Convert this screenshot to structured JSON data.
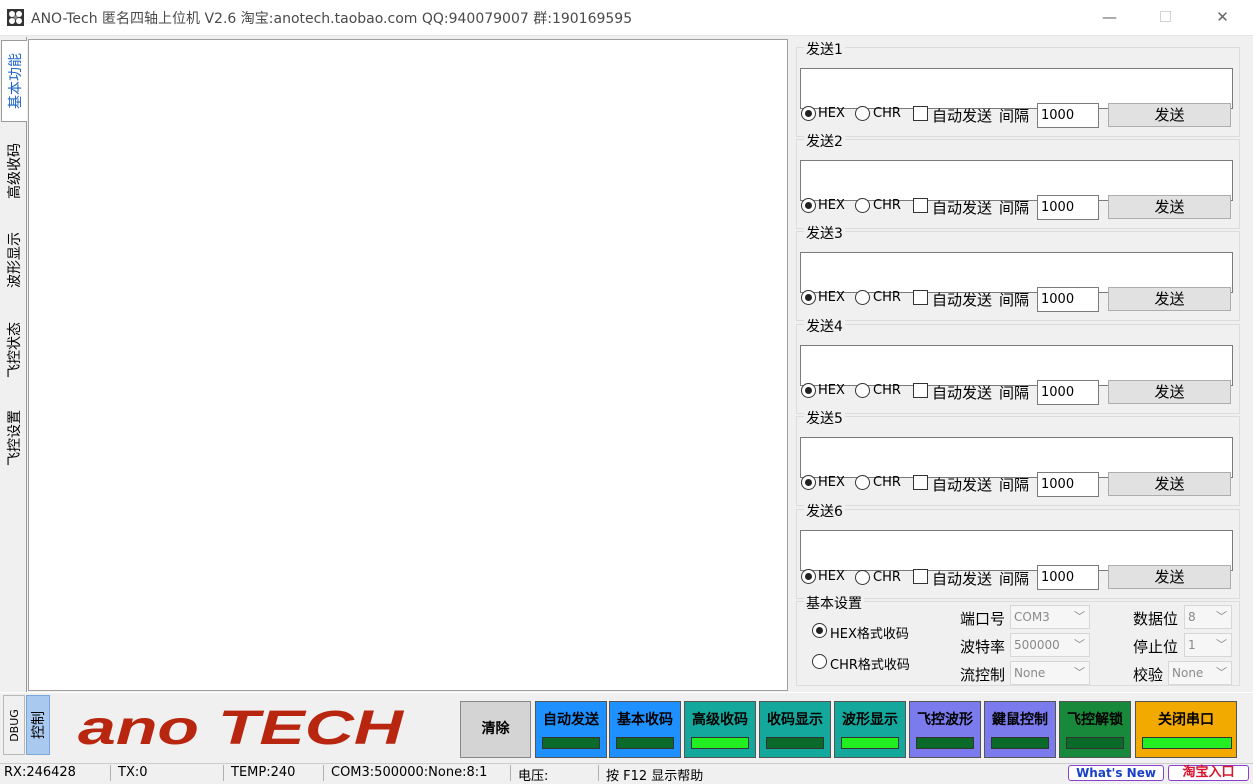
{
  "window": {
    "title": "ANO-Tech  匿名四轴上位机   V2.6  淘宝:anotech.taobao.com   QQ:940079007  群:190169595",
    "minimize": "—",
    "maximize": "☐",
    "close": "✕"
  },
  "left_tabs": [
    "基本功能",
    "高级收码",
    "波形显示",
    "飞控状态",
    "飞控设置"
  ],
  "send_groups": [
    {
      "label": "发送1",
      "hex": "HEX",
      "chr": "CHR",
      "auto": "自动发送",
      "interval_label": "间隔",
      "interval": "1000",
      "send": "发送",
      "selected": "hex"
    },
    {
      "label": "发送2",
      "hex": "HEX",
      "chr": "CHR",
      "auto": "自动发送",
      "interval_label": "间隔",
      "interval": "1000",
      "send": "发送",
      "selected": "hex"
    },
    {
      "label": "发送3",
      "hex": "HEX",
      "chr": "CHR",
      "auto": "自动发送",
      "interval_label": "间隔",
      "interval": "1000",
      "send": "发送",
      "selected": "hex"
    },
    {
      "label": "发送4",
      "hex": "HEX",
      "chr": "CHR",
      "auto": "自动发送",
      "interval_label": "间隔",
      "interval": "1000",
      "send": "发送",
      "selected": "hex"
    },
    {
      "label": "发送5",
      "hex": "HEX",
      "chr": "CHR",
      "auto": "自动发送",
      "interval_label": "间隔",
      "interval": "1000",
      "send": "发送",
      "selected": "hex"
    },
    {
      "label": "发送6",
      "hex": "HEX",
      "chr": "CHR",
      "auto": "自动发送",
      "interval_label": "间隔",
      "interval": "1000",
      "send": "发送",
      "selected": "hex"
    }
  ],
  "settings": {
    "title": "基本设置",
    "hex_mode": "HEX格式收码",
    "chr_mode": "CHR格式收码",
    "port_label": "端口号",
    "port": "COM3",
    "baud_label": "波特率",
    "baud": "500000",
    "flow_label": "流控制",
    "flow": "None",
    "databits_label": "数据位",
    "databits": "8",
    "stopbits_label": "停止位",
    "stopbits": "1",
    "parity_label": "校验",
    "parity": "None"
  },
  "bottom": {
    "dbug": "DBUG",
    "control": "控制",
    "brand": "ano TECH",
    "clear": "清除",
    "buttons": [
      {
        "label": "自动发送",
        "bg": "#1e90ff",
        "ind": "#0a6a2a"
      },
      {
        "label": "基本收码",
        "bg": "#1e90ff",
        "ind": "#0a6a2a"
      },
      {
        "label": "高级收码",
        "bg": "#14a89c",
        "ind": "#22ee22"
      },
      {
        "label": "收码显示",
        "bg": "#14a89c",
        "ind": "#0a6a2a"
      },
      {
        "label": "波形显示",
        "bg": "#14a89c",
        "ind": "#22ee22"
      },
      {
        "label": "飞控波形",
        "bg": "#7b7bee",
        "ind": "#0a6a2a"
      },
      {
        "label": "鍵鼠控制",
        "bg": "#7b7bee",
        "ind": "#0a6a2a"
      },
      {
        "label": "飞控解锁",
        "bg": "#18883a",
        "ind": "#0a6a2a"
      },
      {
        "label": "关闭串口",
        "bg": "#f2a900",
        "ind": "#22ee22"
      }
    ]
  },
  "status": {
    "rx": "RX:246428",
    "tx": "TX:0",
    "temp": "TEMP:240",
    "com": "COM3:500000:None:8:1",
    "voltage": "电压:",
    "help": "按 F12 显示帮助",
    "whats_new": "What's New",
    "taobao": "淘宝入口"
  },
  "colors": {
    "accent": "#1a62c9",
    "brand": "#b8260f"
  }
}
